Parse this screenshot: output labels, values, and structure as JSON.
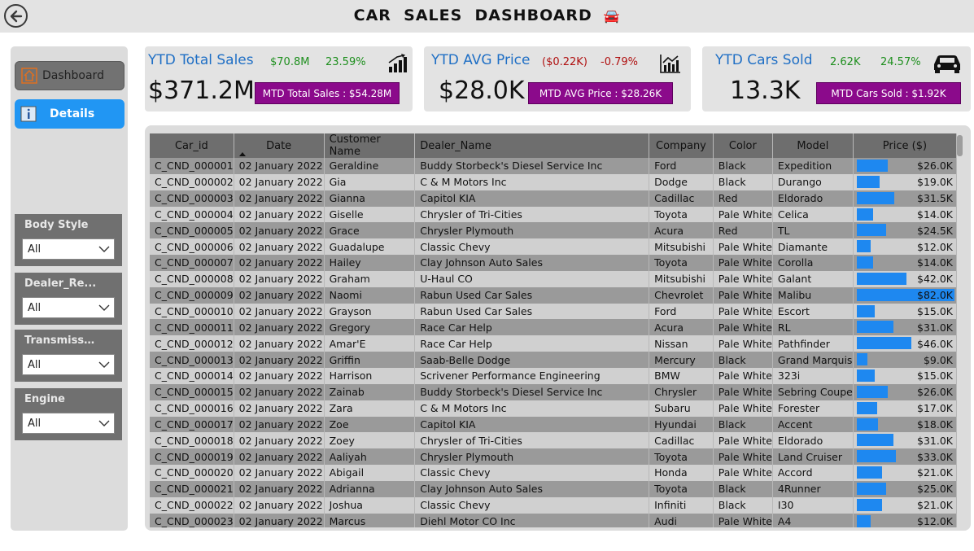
{
  "header": {
    "title": "CAR  SALES  DASHBOARD",
    "title_emoji": "🚘"
  },
  "nav": [
    {
      "label": "Dashboard",
      "icon": "home-icon"
    },
    {
      "label": "Details",
      "icon": "info-icon"
    }
  ],
  "filters": [
    {
      "label": "Body Style",
      "value": "All"
    },
    {
      "label": "Dealer_Re...",
      "value": "All"
    },
    {
      "label": "Transmissi...",
      "value": "All"
    },
    {
      "label": "Engine",
      "value": "All"
    }
  ],
  "kpis": [
    {
      "title": "YTD Total Sales",
      "delta": "$70.8M",
      "pct": "23.59%",
      "value": "$371.2M",
      "mtd": "MTD Total Sales : $54.28M",
      "icon": "bar-growth-icon",
      "delta_color": "#1e8f1e"
    },
    {
      "title": "YTD AVG Price",
      "delta": "($0.22K)",
      "pct": "-0.79%",
      "value": "$28.0K",
      "mtd": "MTD AVG Price : $28.26K",
      "icon": "chart-growth-icon",
      "delta_color": "#b01010"
    },
    {
      "title": "YTD Cars Sold",
      "delta": "2.62K",
      "pct": "24.57%",
      "value": "13.3K",
      "mtd": "MTD Cars Sold : $1.92K",
      "icon": "car-icon",
      "delta_color": "#1e8f1e"
    }
  ],
  "table": {
    "columns": [
      "Car_id",
      "Date",
      "Customer Name",
      "Dealer_Name",
      "Company",
      "Color",
      "Model",
      "Price ($)"
    ],
    "price_max": 82,
    "rows": [
      [
        "C_CND_000001",
        "02 January 2022",
        "Geraldine",
        "Buddy Storbeck's Diesel Service Inc",
        "Ford",
        "Black",
        "Expedition",
        "$26.0K",
        26
      ],
      [
        "C_CND_000002",
        "02 January 2022",
        "Gia",
        "C & M Motors Inc",
        "Dodge",
        "Black",
        "Durango",
        "$19.0K",
        19
      ],
      [
        "C_CND_000003",
        "02 January 2022",
        "Gianna",
        "Capitol KIA",
        "Cadillac",
        "Red",
        "Eldorado",
        "$31.5K",
        31.5
      ],
      [
        "C_CND_000004",
        "02 January 2022",
        "Giselle",
        "Chrysler of Tri-Cities",
        "Toyota",
        "Pale White",
        "Celica",
        "$14.0K",
        14
      ],
      [
        "C_CND_000005",
        "02 January 2022",
        "Grace",
        "Chrysler Plymouth",
        "Acura",
        "Red",
        "TL",
        "$24.5K",
        24.5
      ],
      [
        "C_CND_000006",
        "02 January 2022",
        "Guadalupe",
        "Classic Chevy",
        "Mitsubishi",
        "Pale White",
        "Diamante",
        "$12.0K",
        12
      ],
      [
        "C_CND_000007",
        "02 January 2022",
        "Hailey",
        "Clay Johnson Auto Sales",
        "Toyota",
        "Pale White",
        "Corolla",
        "$14.0K",
        14
      ],
      [
        "C_CND_000008",
        "02 January 2022",
        "Graham",
        "U-Haul CO",
        "Mitsubishi",
        "Pale White",
        "Galant",
        "$42.0K",
        42
      ],
      [
        "C_CND_000009",
        "02 January 2022",
        "Naomi",
        "Rabun Used Car Sales",
        "Chevrolet",
        "Pale White",
        "Malibu",
        "$82.0K",
        82
      ],
      [
        "C_CND_000010",
        "02 January 2022",
        "Grayson",
        "Rabun Used Car Sales",
        "Ford",
        "Pale White",
        "Escort",
        "$15.0K",
        15
      ],
      [
        "C_CND_000011",
        "02 January 2022",
        "Gregory",
        "Race Car Help",
        "Acura",
        "Pale White",
        "RL",
        "$31.0K",
        31
      ],
      [
        "C_CND_000012",
        "02 January 2022",
        "Amar'E",
        "Race Car Help",
        "Nissan",
        "Pale White",
        "Pathfinder",
        "$46.0K",
        46
      ],
      [
        "C_CND_000013",
        "02 January 2022",
        "Griffin",
        "Saab-Belle Dodge",
        "Mercury",
        "Black",
        "Grand Marquis",
        "$9.0K",
        9
      ],
      [
        "C_CND_000014",
        "02 January 2022",
        "Harrison",
        "Scrivener Performance Engineering",
        "BMW",
        "Pale White",
        "323i",
        "$15.0K",
        15
      ],
      [
        "C_CND_000015",
        "02 January 2022",
        "Zainab",
        "Buddy Storbeck's Diesel Service Inc",
        "Chrysler",
        "Pale White",
        "Sebring Coupe",
        "$26.0K",
        26
      ],
      [
        "C_CND_000016",
        "02 January 2022",
        "Zara",
        "C & M Motors Inc",
        "Subaru",
        "Pale White",
        "Forester",
        "$17.0K",
        17
      ],
      [
        "C_CND_000017",
        "02 January 2022",
        "Zoe",
        "Capitol KIA",
        "Hyundai",
        "Black",
        "Accent",
        "$18.0K",
        18
      ],
      [
        "C_CND_000018",
        "02 January 2022",
        "Zoey",
        "Chrysler of Tri-Cities",
        "Cadillac",
        "Pale White",
        "Eldorado",
        "$31.0K",
        31
      ],
      [
        "C_CND_000019",
        "02 January 2022",
        "Aaliyah",
        "Chrysler Plymouth",
        "Toyota",
        "Pale White",
        "Land Cruiser",
        "$33.0K",
        33
      ],
      [
        "C_CND_000020",
        "02 January 2022",
        "Abigail",
        "Classic Chevy",
        "Honda",
        "Pale White",
        "Accord",
        "$21.0K",
        21
      ],
      [
        "C_CND_000021",
        "02 January 2022",
        "Adrianna",
        "Clay Johnson Auto Sales",
        "Toyota",
        "Black",
        "4Runner",
        "$25.0K",
        25
      ],
      [
        "C_CND_000022",
        "02 January 2022",
        "Joshua",
        "Classic Chevy",
        "Infiniti",
        "Black",
        "I30",
        "$21.0K",
        21
      ],
      [
        "C_CND_000023",
        "02 January 2022",
        "Marcus",
        "Diehl Motor CO Inc",
        "Audi",
        "Pale White",
        "A4",
        "$12.0K",
        12
      ]
    ]
  }
}
